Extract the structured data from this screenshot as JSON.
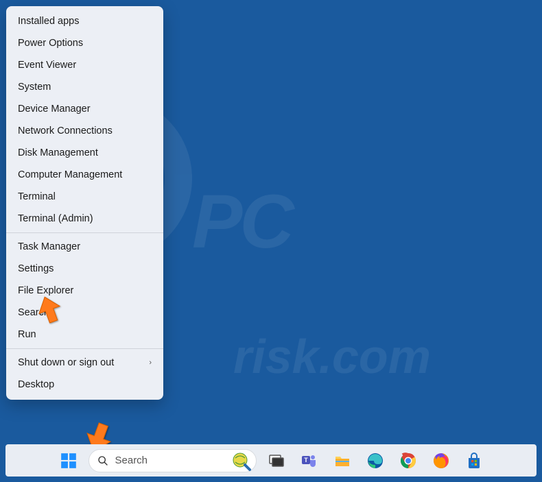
{
  "watermark": {
    "text1": "PC",
    "text2": "risk.com"
  },
  "menu": {
    "groups": [
      [
        {
          "label": "Installed apps",
          "submenu": false
        },
        {
          "label": "Power Options",
          "submenu": false
        },
        {
          "label": "Event Viewer",
          "submenu": false
        },
        {
          "label": "System",
          "submenu": false
        },
        {
          "label": "Device Manager",
          "submenu": false
        },
        {
          "label": "Network Connections",
          "submenu": false
        },
        {
          "label": "Disk Management",
          "submenu": false
        },
        {
          "label": "Computer Management",
          "submenu": false
        },
        {
          "label": "Terminal",
          "submenu": false
        },
        {
          "label": "Terminal (Admin)",
          "submenu": false
        }
      ],
      [
        {
          "label": "Task Manager",
          "submenu": false
        },
        {
          "label": "Settings",
          "submenu": false
        },
        {
          "label": "File Explorer",
          "submenu": false
        },
        {
          "label": "Search",
          "submenu": false
        },
        {
          "label": "Run",
          "submenu": false
        }
      ],
      [
        {
          "label": "Shut down or sign out",
          "submenu": true
        },
        {
          "label": "Desktop",
          "submenu": false
        }
      ]
    ]
  },
  "search": {
    "placeholder": "Search"
  },
  "taskbar_icons": [
    {
      "name": "start",
      "label": "Start"
    },
    {
      "name": "task-view",
      "label": "Task View"
    },
    {
      "name": "teams",
      "label": "Microsoft Teams"
    },
    {
      "name": "file-explorer",
      "label": "File Explorer"
    },
    {
      "name": "edge",
      "label": "Microsoft Edge"
    },
    {
      "name": "chrome",
      "label": "Google Chrome"
    },
    {
      "name": "firefox",
      "label": "Firefox"
    },
    {
      "name": "store",
      "label": "Microsoft Store"
    }
  ]
}
